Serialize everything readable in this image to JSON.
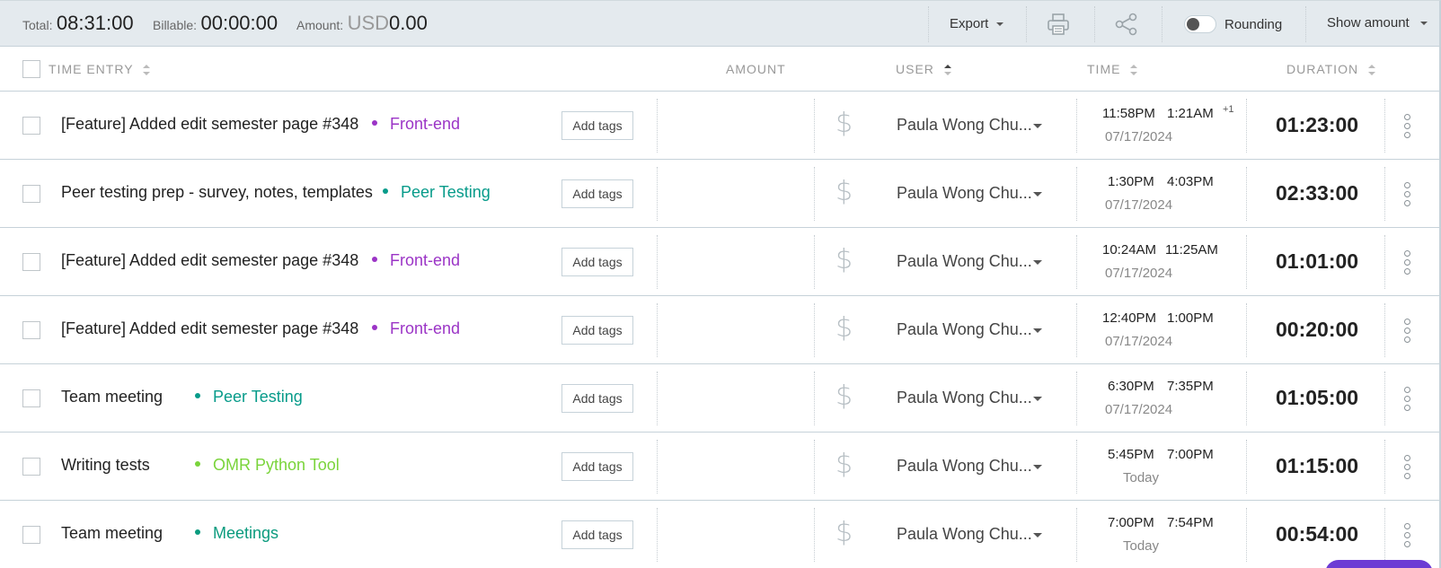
{
  "summary": {
    "total_label": "Total:",
    "total_value": "08:31:00",
    "billable_label": "Billable:",
    "billable_value": "00:00:00",
    "amount_label": "Amount:",
    "amount_currency": "USD",
    "amount_value": "0.00",
    "export_label": "Export",
    "print_icon": "printer-icon",
    "share_icon": "share-icon",
    "rounding_label": "Rounding",
    "rounding_on": false,
    "show_amount_label": "Show amount"
  },
  "columns": {
    "time_entry": "TIME ENTRY",
    "amount": "AMOUNT",
    "user": "USER",
    "time": "TIME",
    "duration": "DURATION"
  },
  "rows": [
    {
      "description": "[Feature] Added edit semester page #348",
      "project": "Front-end",
      "project_color": "#9b34c6",
      "tag_button": "Add tags",
      "user": "Paula Wong Chu...",
      "start": "11:58PM",
      "end": "1:21AM",
      "extra_day": "+1",
      "date": "07/17/2024",
      "duration": "01:23:00"
    },
    {
      "description": "Peer testing prep - survey, notes, templates",
      "project": "Peer Testing",
      "project_color": "#079b8a",
      "tag_button": "Add tags",
      "user": "Paula Wong Chu...",
      "start": "1:30PM",
      "end": "4:03PM",
      "extra_day": "",
      "date": "07/17/2024",
      "duration": "02:33:00"
    },
    {
      "description": "[Feature] Added edit semester page #348",
      "project": "Front-end",
      "project_color": "#9b34c6",
      "tag_button": "Add tags",
      "user": "Paula Wong Chu...",
      "start": "10:24AM",
      "end": "11:25AM",
      "extra_day": "",
      "date": "07/17/2024",
      "duration": "01:01:00"
    },
    {
      "description": "[Feature] Added edit semester page #348",
      "project": "Front-end",
      "project_color": "#9b34c6",
      "tag_button": "Add tags",
      "user": "Paula Wong Chu...",
      "start": "12:40PM",
      "end": "1:00PM",
      "extra_day": "",
      "date": "07/17/2024",
      "duration": "00:20:00"
    },
    {
      "description": "Team meeting",
      "project": "Peer Testing",
      "project_color": "#079b8a",
      "tag_button": "Add tags",
      "user": "Paula Wong Chu...",
      "start": "6:30PM",
      "end": "7:35PM",
      "extra_day": "",
      "date": "07/17/2024",
      "duration": "01:05:00"
    },
    {
      "description": "Writing tests",
      "project": "OMR Python Tool",
      "project_color": "#7ad43b",
      "tag_button": "Add tags",
      "user": "Paula Wong Chu...",
      "start": "5:45PM",
      "end": "7:00PM",
      "extra_day": "",
      "date": "Today",
      "duration": "01:15:00"
    },
    {
      "description": "Team meeting",
      "project": "Meetings",
      "project_color": "#0b9b7e",
      "tag_button": "Add tags",
      "user": "Paula Wong Chu...",
      "start": "7:00PM",
      "end": "7:54PM",
      "extra_day": "",
      "date": "Today",
      "duration": "00:54:00"
    }
  ]
}
